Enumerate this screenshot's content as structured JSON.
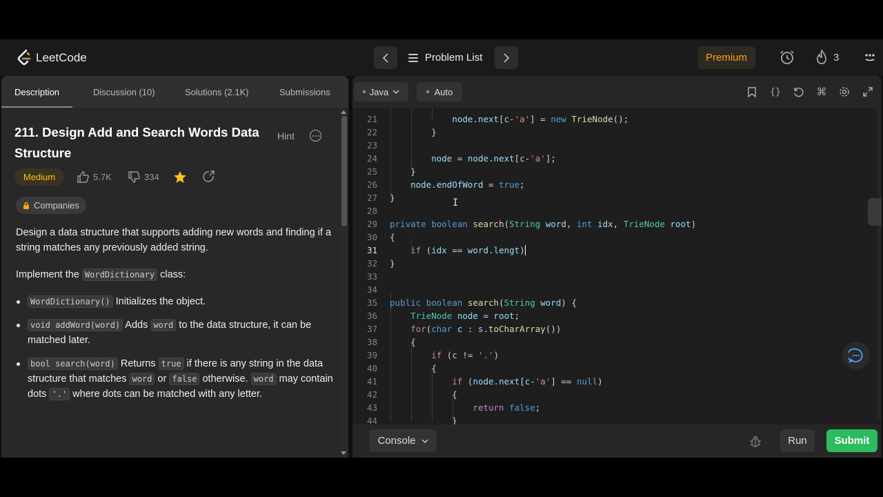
{
  "navbar": {
    "logo_text": "LeetCode",
    "problem_list": "Problem List",
    "premium": "Premium",
    "streak_count": "3",
    "icons": [
      "chevron-left-icon",
      "chevron-right-icon",
      "list-icon",
      "alarm-icon",
      "flame-icon",
      "apps-icon"
    ]
  },
  "left_tabs": [
    "Description",
    "Discussion (10)",
    "Solutions (2.1K)",
    "Submissions"
  ],
  "problem": {
    "title": "211. Design Add and Search Words Data Structure",
    "hint": "Hint",
    "difficulty": "Medium",
    "likes": "5.7K",
    "dislikes": "334",
    "companies": "Companies",
    "intro": "Design a data structure that supports adding new words and finding if a string matches any previously added string.",
    "implement_pre": "Implement the ",
    "implement_code": "WordDictionary",
    "implement_post": " class:",
    "b1_code": "WordDictionary()",
    "b1_text": " Initializes the object.",
    "b2_code": "void addWord(word)",
    "b2_text1": " Adds ",
    "b2_code2": "word",
    "b2_text2": " to the data structure, it can be matched later.",
    "b3_code": "bool search(word)",
    "b3_text1": " Returns ",
    "b3_code2": "true",
    "b3_text2": " if there is any string in the data structure that matches ",
    "b3_code3": "word",
    "b3_text3": " or ",
    "b3_code4": "false",
    "b3_text4": " otherwise. ",
    "b3_code5": "word",
    "b3_text5": " may contain dots ",
    "b3_code6": "'.'",
    "b3_text6": " where dots can be matched with any letter."
  },
  "editor": {
    "language": "Java",
    "mode": "Auto",
    "current_line": 31,
    "line_numbers": [
      "21",
      "22",
      "23",
      "24",
      "25",
      "26",
      "27",
      "28",
      "29",
      "30",
      "31",
      "32",
      "33",
      "34",
      "35",
      "36",
      "37",
      "38",
      "39",
      "40",
      "41",
      "42",
      "43",
      "44"
    ]
  },
  "bottom": {
    "console": "Console",
    "run": "Run",
    "submit": "Submit"
  },
  "colors": {
    "accent": "#ffa116",
    "submit": "#2cbb5d",
    "medium": "#ffc01e"
  }
}
